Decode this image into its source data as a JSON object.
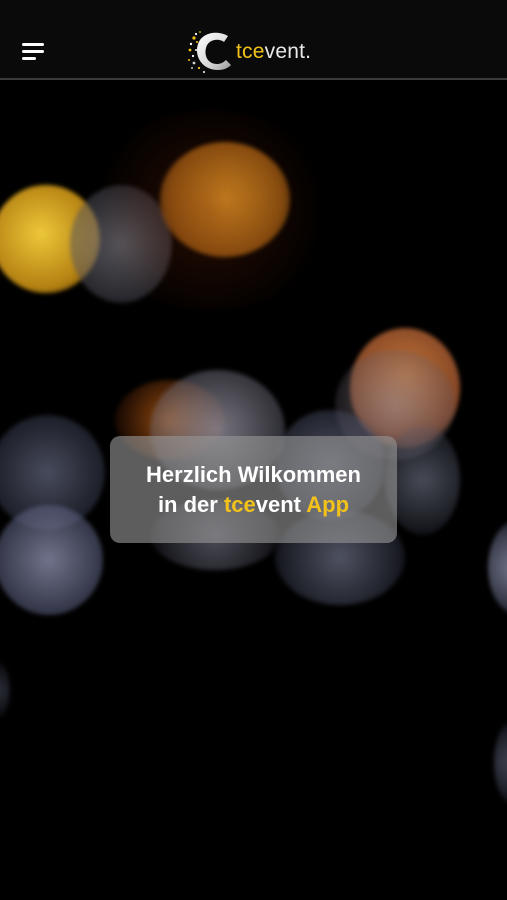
{
  "header": {
    "menu_icon": "hamburger-menu-icon",
    "logo_icon": "tcevent-logo-c-icon",
    "brand_accent": "tce",
    "brand_rest": "vent.",
    "accent_color": "#f2c21b"
  },
  "welcome": {
    "line1": "Herzlich Wilkommen",
    "line2_prefix": "in der ",
    "line2_brand_accent": "tce",
    "line2_brand_rest": "vent ",
    "line2_app": "App"
  }
}
